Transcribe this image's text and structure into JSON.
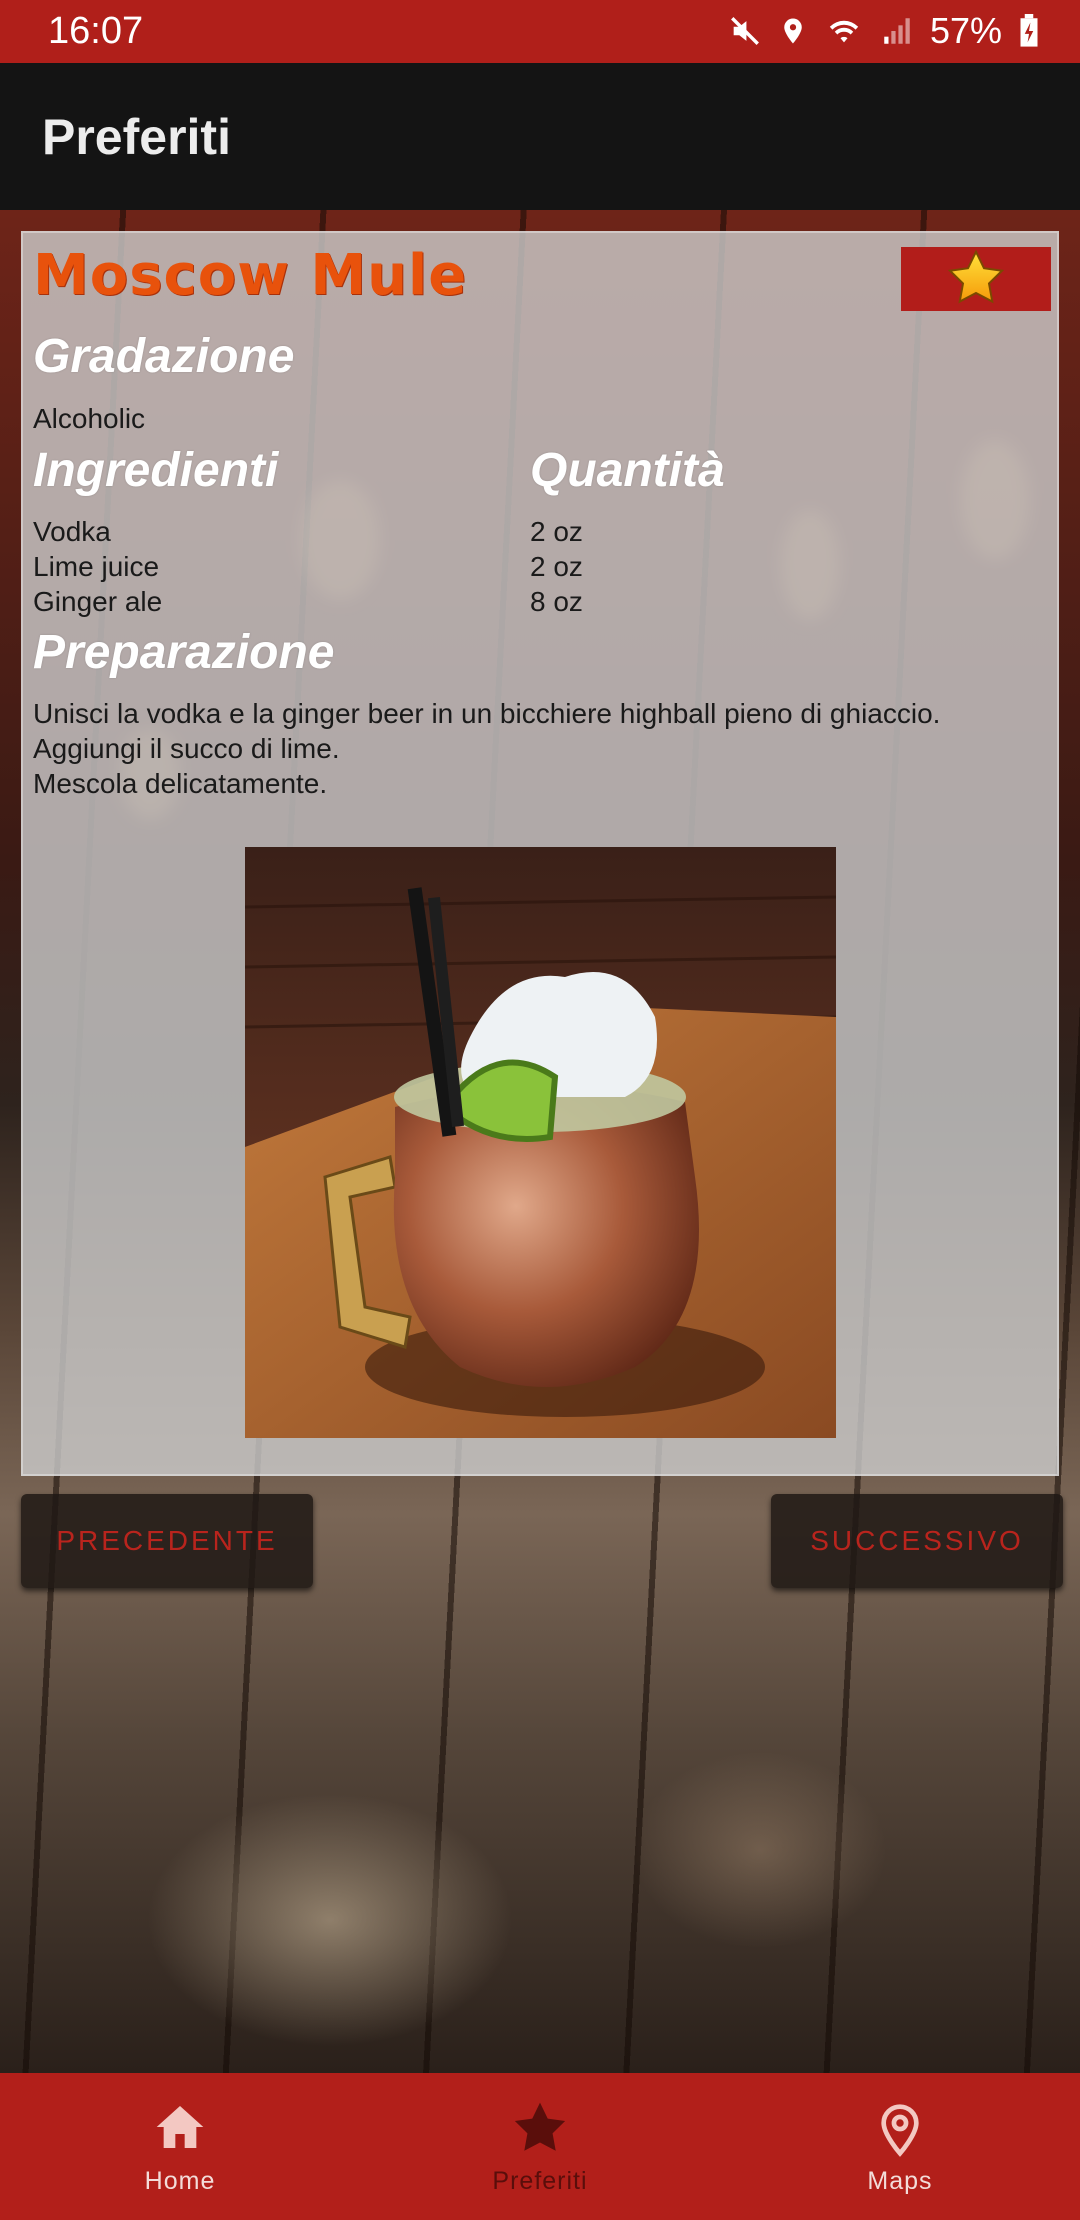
{
  "status_bar": {
    "time": "16:07",
    "battery": "57%",
    "icons": [
      "mute-icon",
      "location-icon",
      "wifi-icon",
      "signal-icon",
      "battery-icon"
    ]
  },
  "app_bar": {
    "title": "Preferiti"
  },
  "card": {
    "drink_name": "Moscow Mule",
    "favorite_icon": "star-icon",
    "gradazione_heading": "Gradazione",
    "gradazione_value": "Alcoholic",
    "ingredienti_heading": "Ingredienti",
    "quantita_heading": "Quantità",
    "ingredients": [
      {
        "name": "Vodka",
        "qty": "2 oz"
      },
      {
        "name": "Lime juice",
        "qty": "2 oz"
      },
      {
        "name": "Ginger ale",
        "qty": "8 oz"
      }
    ],
    "preparazione_heading": "Preparazione",
    "preparazione_lines": [
      "Unisci la vodka e la ginger beer in un bicchiere highball pieno di ghiaccio.",
      "Aggiungi il succo di lime.",
      "Mescola delicatamente."
    ]
  },
  "buttons": {
    "previous": "PRECEDENTE",
    "next": "SUCCESSIVO"
  },
  "bottom_nav": {
    "tabs": [
      {
        "label": "Home",
        "icon": "home-icon"
      },
      {
        "label": "Preferiti",
        "icon": "star-icon",
        "active": true
      },
      {
        "label": "Maps",
        "icon": "map-pin-icon"
      }
    ]
  },
  "colors": {
    "primary": "#b21f1a",
    "app_bar": "#141414",
    "drink_name": "#e8520c",
    "button_text": "#b9241d",
    "tab_inactive": "#f3dcd9",
    "tab_active": "#5a0e0b"
  }
}
